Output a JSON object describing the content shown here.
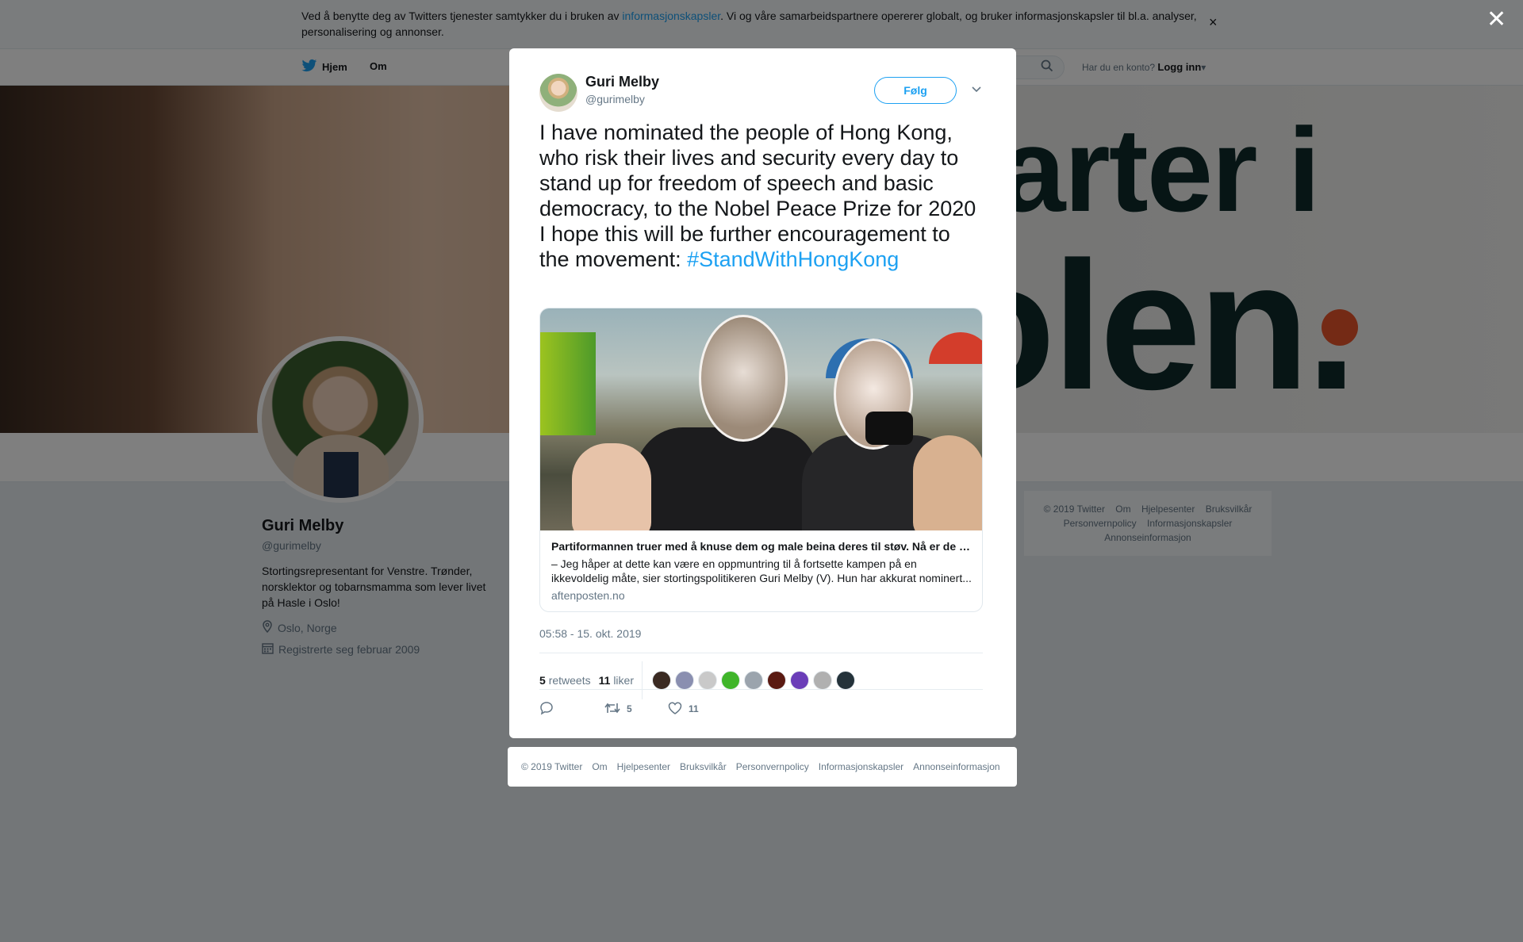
{
  "cookie_banner": {
    "text_before": "Ved å benytte deg av Twitters tjenester samtykker du i bruken av ",
    "link": "informasjonskapsler",
    "text_after": ". Vi og våre samarbeidspartnere opererer globalt, og bruker informasjonskapsler til bl.a. analyser, personalisering og annonser.",
    "close": "×"
  },
  "nav": {
    "home": "Hjem",
    "about": "Om",
    "account_prompt": "Har du en konto?",
    "login": "Logg inn"
  },
  "header": {
    "line1": "arter i",
    "line2": "olen."
  },
  "profile": {
    "name": "Guri Melby",
    "handle": "@gurimelby",
    "bio": "Stortingsrepresentant for Venstre. Trønder, norsklektor og tobarnsmamma som lever livet på Hasle i Oslo!",
    "location": "Oslo, Norge",
    "joined": "Registrerte seg februar 2009"
  },
  "sidebar_footer": {
    "items": [
      "© 2019 Twitter",
      "Om",
      "Hjelpesenter",
      "Bruksvilkår",
      "Personvernpolicy",
      "Informasjonskapsler",
      "Annonseinformasjon"
    ]
  },
  "overlay": {
    "close": "✕"
  },
  "tweet": {
    "author_name": "Guri Melby",
    "author_handle": "@gurimelby",
    "follow_label": "Følg",
    "text": "I have nominated the people of Hong Kong, who risk their lives and security every day to stand up for freedom of speech and basic democracy, to the Nobel Peace Prize for 2020 I hope this will be further encouragement to the movement: ",
    "hashtag": "#StandWithHongKong",
    "card": {
      "title": "Partiformannen truer med å knuse dem og male beina deres til støv. Nå er de nominert til Nobels fredspris.",
      "description": "– Jeg håper at dette kan være en oppmuntring til å fortsette kampen på en ikkevoldelig måte, sier stortingspolitikeren Guri Melby (V). Hun har akkurat nominert...",
      "domain": "aftenposten.no"
    },
    "timestamp": "05:58 - 15. okt. 2019",
    "retweets_count": "5",
    "retweets_label": "retweets",
    "likes_count": "11",
    "likes_label": "liker",
    "liker_colors": [
      "#3a2a22",
      "#8a8fb0",
      "#c9c9c9",
      "#3fb52a",
      "#9ba4ad",
      "#5a1a12",
      "#6a3db8",
      "#b0b0b0",
      "#24323a"
    ],
    "action_retweets": "5",
    "action_likes": "11"
  },
  "modal_footer": {
    "items": [
      "© 2019 Twitter",
      "Om",
      "Hjelpesenter",
      "Bruksvilkår",
      "Personvernpolicy",
      "Informasjonskapsler",
      "Annonseinformasjon"
    ]
  },
  "colors": {
    "accent": "#1da1f2",
    "secondary_text": "#657786",
    "background": "#e6ecf0"
  }
}
